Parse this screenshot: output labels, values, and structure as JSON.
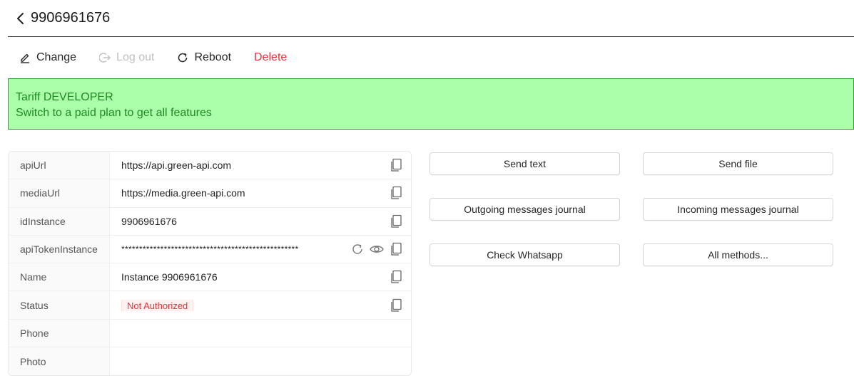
{
  "header": {
    "title": "9906961676"
  },
  "toolbar": {
    "change_label": "Change",
    "logout_label": "Log out",
    "reboot_label": "Reboot",
    "delete_label": "Delete",
    "delete_color": "#e8313b"
  },
  "banner": {
    "line1": "Tariff DEVELOPER",
    "line2": "Switch to a paid plan to get all features",
    "bg_color": "#abffab",
    "text_color": "#1e8a1e"
  },
  "details": {
    "rows": [
      {
        "label": "apiUrl",
        "value": "https://api.green-api.com"
      },
      {
        "label": "mediaUrl",
        "value": "https://media.green-api.com"
      },
      {
        "label": "idInstance",
        "value": "9906961676"
      },
      {
        "label": "apiTokenInstance",
        "value": "**************************************************"
      },
      {
        "label": "Name",
        "value": "Instance 9906961676"
      },
      {
        "label": "Status",
        "value": "Not Authorized"
      },
      {
        "label": "Phone",
        "value": ""
      },
      {
        "label": "Photo",
        "value": ""
      }
    ]
  },
  "actions": {
    "send_text": "Send text",
    "send_file": "Send file",
    "outgoing_journal": "Outgoing messages journal",
    "incoming_journal": "Incoming messages journal",
    "check_whatsapp": "Check Whatsapp",
    "all_methods": "All methods..."
  }
}
